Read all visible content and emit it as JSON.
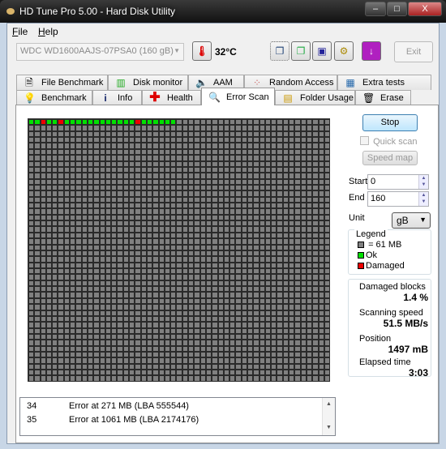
{
  "window": {
    "title": "HD Tune Pro 5.00 - Hard Disk Utility",
    "minimize": "‒",
    "maximize": "□",
    "close": "X"
  },
  "menu": [
    {
      "label": "File",
      "accel": "F",
      "rest": "ile"
    },
    {
      "label": "Help",
      "accel": "H",
      "rest": "elp"
    }
  ],
  "toolbar": {
    "drive": "WDC WD1600AAJS-07PSA0 (160 gB)",
    "temperature": "32°C",
    "exit": "Exit",
    "buttons": [
      "copy-info-icon",
      "copy-screenshot-icon",
      "save-icon",
      "options-icon",
      "download-icon"
    ]
  },
  "tabs_row1": [
    "File Benchmark",
    "Disk monitor",
    "AAM",
    "Random Access",
    "Extra tests"
  ],
  "tabs_row2": [
    "Benchmark",
    "Info",
    "Health",
    "Error Scan",
    "Folder Usage",
    "Erase"
  ],
  "active_tab": "Error Scan",
  "scan": {
    "block_status": [
      "ok",
      "ok",
      "damaged",
      "ok",
      "ok",
      "damaged",
      "ok",
      "ok",
      "ok",
      "ok",
      "ok",
      "ok",
      "ok",
      "ok",
      "ok",
      "ok",
      "ok",
      "ok",
      "damaged",
      "ok",
      "ok",
      "ok",
      "ok",
      "ok",
      "ok"
    ],
    "colors": {
      "unscanned": "#808080",
      "ok": "#00e000",
      "damaged": "#ee0000"
    }
  },
  "log": [
    {
      "num": "34",
      "msg": "Error at 271 MB (LBA 555544)"
    },
    {
      "num": "35",
      "msg": "Error at 1061 MB (LBA 2174176)"
    }
  ],
  "controls": {
    "stop": "Stop",
    "quick_scan": "Quick scan",
    "quick_scan_checked": false,
    "speed_map": "Speed map",
    "start_label": "Start",
    "start": "0",
    "end_label": "End",
    "end": "160",
    "unit_label": "Unit",
    "unit": "gB"
  },
  "legend": {
    "title": "Legend",
    "block": "= 61 MB",
    "ok": "Ok",
    "damaged": "Damaged"
  },
  "stats": {
    "damaged_label": "Damaged blocks",
    "damaged": "1.4 %",
    "speed_label": "Scanning speed",
    "speed": "51.5 MB/s",
    "position_label": "Position",
    "position": "1497 mB",
    "elapsed_label": "Elapsed time",
    "elapsed": "3:03"
  }
}
